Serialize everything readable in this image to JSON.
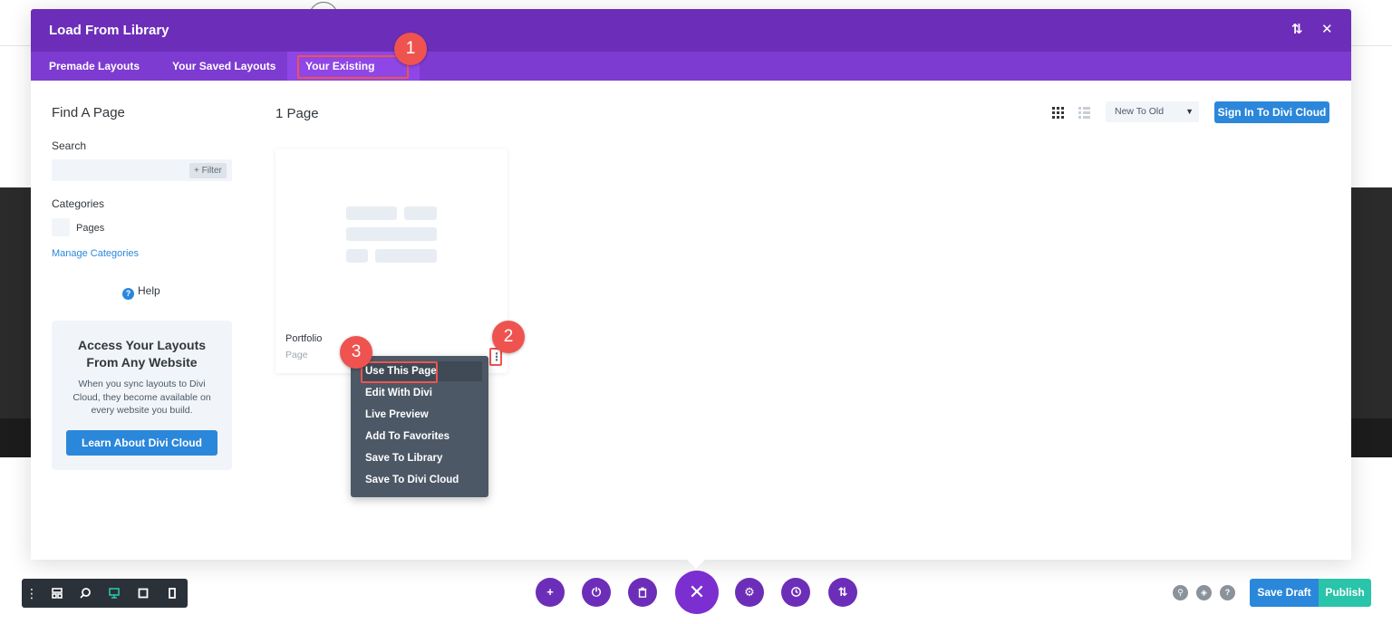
{
  "modal": {
    "title": "Load From Library",
    "header_icons": [
      "sort-icon",
      "close-icon"
    ],
    "tabs": [
      {
        "label": "Premade Layouts",
        "active": false
      },
      {
        "label": "Your Saved Layouts",
        "active": false
      },
      {
        "label": "Your Existing Pages",
        "active": true
      }
    ]
  },
  "annotations": {
    "step1": "1",
    "step2": "2",
    "step3": "3",
    "highlight_color": "#ef5350"
  },
  "sidebar": {
    "title": "Find A Page",
    "search_label": "Search",
    "search_value": "",
    "filter_label": "+ Filter",
    "categories_label": "Categories",
    "categories": [
      {
        "label": "Pages",
        "checked": false
      }
    ],
    "manage_link": "Manage Categories",
    "help_label": "Help",
    "promo": {
      "title": "Access Your Layouts From Any Website",
      "text": "When you sync layouts to Divi Cloud, they become available on every website you build.",
      "button": "Learn About Divi Cloud"
    }
  },
  "main": {
    "page_count": "1 Page",
    "view_modes": [
      "grid-view-icon",
      "list-view-icon"
    ],
    "sort_selected": "New To Old",
    "cloud_button": "Sign In To Divi Cloud",
    "cards": [
      {
        "name": "Portfolio",
        "type": "Page"
      }
    ]
  },
  "context_menu": {
    "items": [
      "Use This Page",
      "Edit With Divi",
      "Live Preview",
      "Add To Favorites",
      "Save To Library",
      "Save To Divi Cloud"
    ]
  },
  "bottom_bar": {
    "left_icons": [
      "more-icon",
      "layers-icon",
      "zoom-icon",
      "desktop-icon",
      "tablet-icon",
      "phone-icon"
    ],
    "center_icons": [
      "add-icon",
      "power-icon",
      "trash-icon",
      "close-icon",
      "settings-icon",
      "history-icon",
      "portability-icon"
    ],
    "right_icons": [
      "search-icon",
      "layers-icon",
      "help-icon"
    ],
    "save_draft": "Save Draft",
    "publish": "Publish"
  },
  "colors": {
    "purple_dark": "#6c2eb9",
    "purple": "#7d3bd1",
    "blue": "#2b87da",
    "green": "#29c4a9",
    "menu": "#4c5866"
  }
}
